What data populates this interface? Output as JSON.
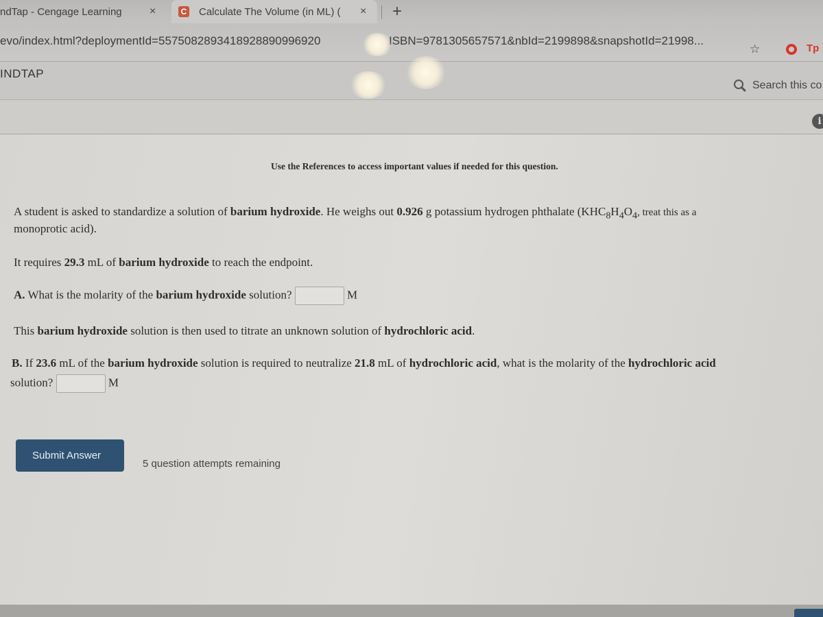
{
  "browser": {
    "tabs": [
      {
        "title": "ndTap - Cengage Learning",
        "active": false,
        "close_label": "×"
      },
      {
        "title": "Calculate The Volume (in ML) (",
        "active": true,
        "favicon": "C",
        "close_label": "×"
      }
    ],
    "new_tab_label": "+",
    "url_part1": "evo/index.html?deploymentId=5575082893418928890996920",
    "url_part2": "ISBN=9781305657571&nbId=2199898&snapshotId=21998...",
    "bookmark_icon": "☆",
    "extension_label": "Tp"
  },
  "app": {
    "brand": "INDTAP",
    "search_placeholder": "Search this co",
    "info_icon": "i"
  },
  "question": {
    "references_note": "Use the References to access important values if needed for this question.",
    "intro": {
      "t1": "A student is asked to standardize a solution of ",
      "b1": "barium hydroxide",
      "t2": ". He weighs out ",
      "b2": "0.926",
      "t3": " g potassium hydrogen phthalate (KHC",
      "s1": "8",
      "t4": "H",
      "s2": "4",
      "t5": "O",
      "s3": "4",
      "t6": ", treat this as a",
      "t7": "monoprotic acid)."
    },
    "endpoint": {
      "t1": "It requires ",
      "b1": "29.3",
      "t2": " mL of ",
      "b2": "barium hydroxide",
      "t3": " to reach the endpoint."
    },
    "part_a": {
      "label": "A.",
      "t1": " What is the molarity of the ",
      "b1": "barium hydroxide",
      "t2": " solution?",
      "value": "",
      "unit": "M"
    },
    "titrate": {
      "t1": "This ",
      "b1": "barium hydroxide",
      "t2": " solution is then used to titrate an unknown solution of ",
      "b2": "hydrochloric acid",
      "t3": "."
    },
    "part_b": {
      "label": "B.",
      "t1": " If ",
      "b1": "23.6",
      "t2": " mL of the ",
      "b2": "barium hydroxide",
      "t3": " solution is required to neutralize ",
      "b3": "21.8",
      "t4": " mL of ",
      "b4": "hydrochloric acid",
      "t5": ", what is the molarity of the ",
      "b5": "hydrochloric acid",
      "t6": "solution?",
      "value": "",
      "unit": "M"
    },
    "submit_label": "Submit Answer",
    "attempts_text": "5 question attempts remaining"
  },
  "colors": {
    "submit_button": "#2f5272",
    "favicon": "#c9573f",
    "opera_red": "#d8342c"
  }
}
